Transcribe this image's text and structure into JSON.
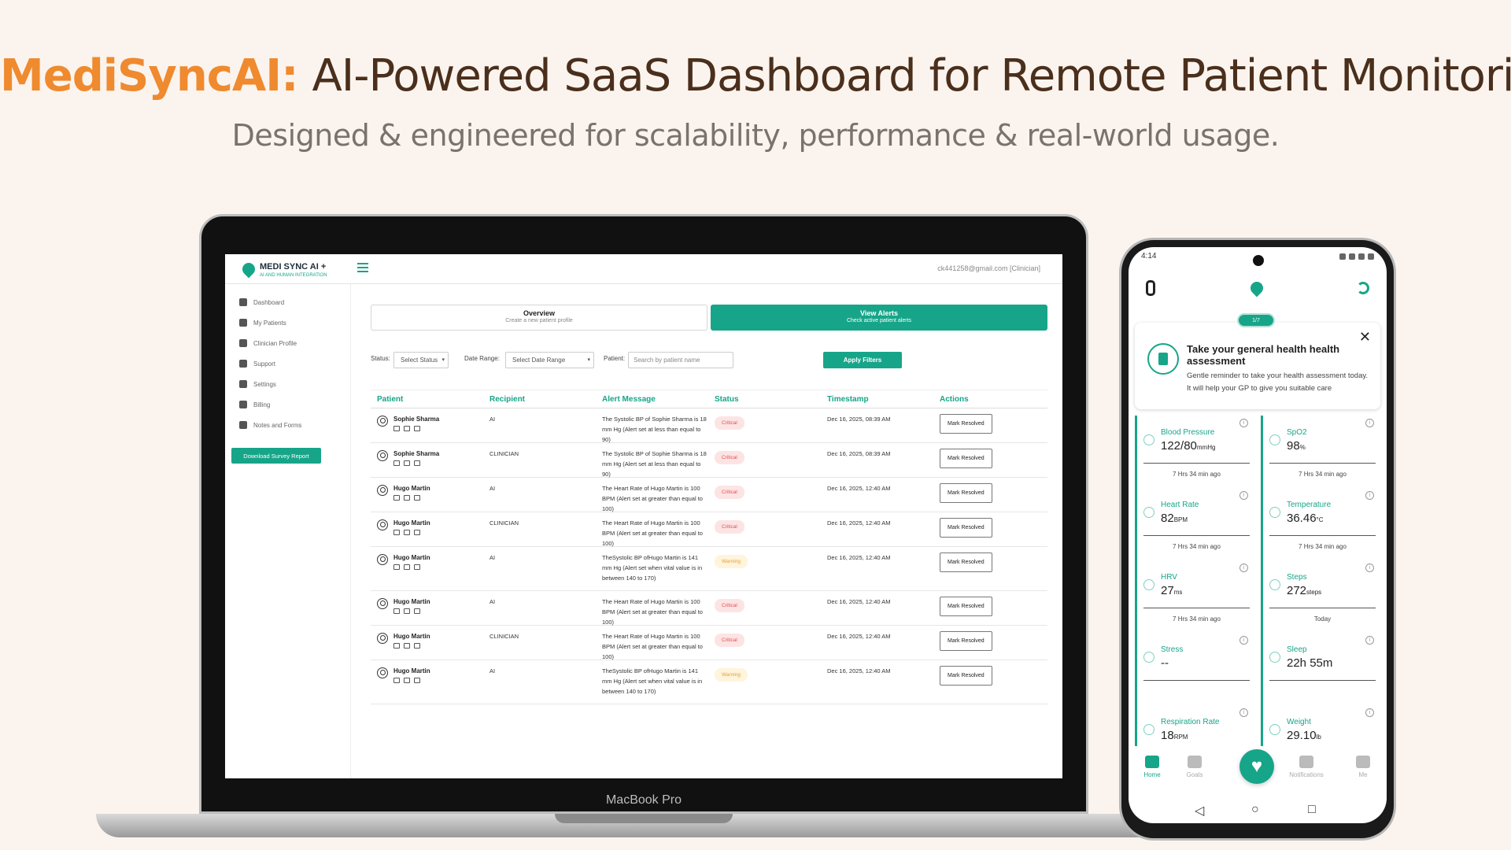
{
  "hero": {
    "brand": "MediSyncAI:",
    "title": "AI-Powered SaaS Dashboard for Remote Patient Monitoring",
    "subtitle": "Designed & engineered for scalability, performance & real-world usage."
  },
  "device": {
    "laptop_label": "MacBook Pro"
  },
  "app": {
    "logo_title": "MEDI SYNC AI +",
    "logo_tagline": "AI AND HUMAN INTEGRATION",
    "user_email": "ck441258@gmail.com [Clinician]",
    "sidebar": {
      "items": [
        {
          "label": "Dashboard",
          "icon": "dashboard-icon"
        },
        {
          "label": "My Patients",
          "icon": "patients-icon"
        },
        {
          "label": "Clinician Profile",
          "icon": "profile-icon"
        },
        {
          "label": "Support",
          "icon": "support-icon"
        },
        {
          "label": "Settings",
          "icon": "gear-icon"
        },
        {
          "label": "Billing",
          "icon": "billing-icon"
        },
        {
          "label": "Notes and Forms",
          "icon": "notes-icon"
        }
      ],
      "download_label": "Download Survey Report"
    },
    "tabs": [
      {
        "label": "Overview",
        "sub": "Create a new patient profile"
      },
      {
        "label": "View Alerts",
        "sub": "Check active patient alerts"
      }
    ],
    "filters": {
      "status_label": "Status:",
      "status_value": "Select Status",
      "date_label": "Date Range:",
      "date_value": "Select Date Range",
      "patient_label": "Patient:",
      "patient_placeholder": "Search by patient name",
      "apply_label": "Apply Filters"
    },
    "table": {
      "headers": [
        "Patient",
        "Recipient",
        "Alert Message",
        "Status",
        "Timestamp",
        "Actions"
      ],
      "action_label": "Mark Resolved",
      "rows": [
        {
          "patient": "Sophie Sharma",
          "recipient": "AI",
          "message": "The Systolic BP of Sophie Sharma is 18 mm Hg (Alert set at less than equal to 90)",
          "status": "Critical",
          "timestamp": "Dec 16, 2025, 08:39 AM"
        },
        {
          "patient": "Sophie Sharma",
          "recipient": "CLINICIAN",
          "message": "The Systolic BP of Sophie Sharma is 18 mm Hg (Alert set at less than equal to 90)",
          "status": "Critical",
          "timestamp": "Dec 16, 2025, 08:39 AM"
        },
        {
          "patient": "Hugo Martin",
          "recipient": "AI",
          "message": "The Heart Rate of Hugo Martin is 100 BPM (Alert set at greater than equal to 100)",
          "status": "Critical",
          "timestamp": "Dec 16, 2025, 12:40 AM"
        },
        {
          "patient": "Hugo Martin",
          "recipient": "CLINICIAN",
          "message": "The Heart Rate of Hugo Martin is 100 BPM (Alert set at greater than equal to 100)",
          "status": "Critical",
          "timestamp": "Dec 16, 2025, 12:40 AM"
        },
        {
          "patient": "Hugo Martin",
          "recipient": "AI",
          "message": "TheSystolic BP ofHugo Martin is 141 mm Hg (Alert set when vital value is in between 140 to 170)",
          "status": "Warning",
          "timestamp": "Dec 16, 2025, 12:40 AM"
        },
        {
          "patient": "Hugo Martin",
          "recipient": "AI",
          "message": "The Heart Rate of Hugo Martin is 100 BPM (Alert set at greater than equal to 100)",
          "status": "Critical",
          "timestamp": "Dec 16, 2025, 12:40 AM"
        },
        {
          "patient": "Hugo Martin",
          "recipient": "CLINICIAN",
          "message": "The Heart Rate of Hugo Martin is 100 BPM (Alert set at greater than equal to 100)",
          "status": "Critical",
          "timestamp": "Dec 16, 2025, 12:40 AM"
        },
        {
          "patient": "Hugo Martin",
          "recipient": "AI",
          "message": "TheSystolic BP ofHugo Martin is 141 mm Hg (Alert set when vital value is in between 140 to 170)",
          "status": "Warning",
          "timestamp": "Dec 16, 2025, 12:40 AM"
        }
      ]
    }
  },
  "phone": {
    "status_time": "4:14",
    "pager": "1/7",
    "reminder": {
      "title": "Take your general health health assessment",
      "text": "Gentle reminder to take your health assessment today. It will help your GP to give you suitable care"
    },
    "vitals": [
      {
        "name": "Blood Pressure",
        "value": "122/80",
        "unit": "mmHg",
        "time": "7 Hrs 34 min ago"
      },
      {
        "name": "SpO2",
        "value": "98",
        "unit": "%",
        "time": "7 Hrs 34 min ago"
      },
      {
        "name": "Heart Rate",
        "value": "82",
        "unit": "BPM",
        "time": "7 Hrs 34 min ago"
      },
      {
        "name": "Temperature",
        "value": "36.46",
        "unit": "°C",
        "time": "7 Hrs 34 min ago"
      },
      {
        "name": "HRV",
        "value": "27",
        "unit": "ms",
        "time": "7 Hrs 34 min ago"
      },
      {
        "name": "Steps",
        "value": "272",
        "unit": "steps",
        "time": "Today"
      },
      {
        "name": "Stress",
        "value": "--",
        "unit": "",
        "time": ""
      },
      {
        "name": "Sleep",
        "value": "22h 55m",
        "unit": "",
        "time": ""
      },
      {
        "name": "Respiration Rate",
        "value": "18",
        "unit": "RPM",
        "time": ""
      },
      {
        "name": "Weight",
        "value": "29.10",
        "unit": "lb",
        "time": ""
      }
    ],
    "nav": [
      "Home",
      "Goals",
      "",
      "Notifications",
      "Me"
    ]
  },
  "colors": {
    "accent": "#17a589",
    "brand": "#ef8a2f"
  }
}
